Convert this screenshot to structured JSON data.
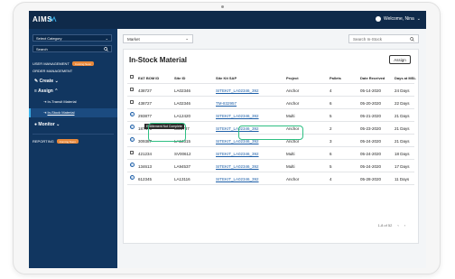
{
  "header": {
    "logo_text": "AIMS",
    "welcome_text": "Welcome, Nina"
  },
  "sidebar": {
    "category_select": "Select Category",
    "search_placeholder": "Search",
    "user_management": "USER MANAGEMENT",
    "order_management": "ORDER MANAGEMENT",
    "coming_soon": "Coming Soon",
    "create": "Create",
    "assign": "Assign",
    "in_transit": "In-Transit Material",
    "in_stock": "In-Stock Material",
    "monitor": "Monitor",
    "reporting": "REPORTING"
  },
  "main": {
    "market_select": "Market",
    "search_placeholder": "Search In-Stock",
    "title": "In-Stock Material",
    "assign_button": "Assign",
    "tooltip": "Entitlement Not Complete",
    "pagination": "1-8 of 52"
  },
  "table": {
    "columns": [
      "EAT BOM ID",
      "Site ID",
      "Site Kit SAP",
      "Project",
      "Pallets",
      "Date Received",
      "Days at MSL"
    ],
    "rows": [
      {
        "icon": "checkbox",
        "bom": "438727",
        "site": "LA02346",
        "sap": "SITEKIT_LA02346_392",
        "project": "Anchor",
        "pallets": "4",
        "date": "05-14-2020",
        "days": "24 Days"
      },
      {
        "icon": "checkbox",
        "bom": "438727",
        "site": "LA02346",
        "sap": "TM-832957",
        "project": "Anchor",
        "pallets": "6",
        "date": "05-20-2020",
        "days": "22 Days"
      },
      {
        "icon": "info",
        "bom": "293877",
        "site": "LA12420",
        "sap": "SITEKIT_LA02346_392",
        "project": "Multi",
        "pallets": "5",
        "date": "05-21-2020",
        "days": "21 Days"
      },
      {
        "icon": "info",
        "bom": "187476",
        "site": "IE25737",
        "sap": "SITEKIT_LA02346_392",
        "project": "Anchor",
        "pallets": "2",
        "date": "05-23-2020",
        "days": "21 Days"
      },
      {
        "icon": "info",
        "bom": "309387",
        "site": "LA12315",
        "sap": "SITEKIT_LA02346_392",
        "project": "Anchor",
        "pallets": "3",
        "date": "05-24-2020",
        "days": "21 Days"
      },
      {
        "icon": "checkbox",
        "bom": "421234",
        "site": "SV00612",
        "sap": "SITEKIT_LA02346_392",
        "project": "Multi",
        "pallets": "6",
        "date": "05-24-2020",
        "days": "18 Days"
      },
      {
        "icon": "info",
        "bom": "134613",
        "site": "LA94537",
        "sap": "SITEKIT_LA02346_392",
        "project": "Multi",
        "pallets": "5",
        "date": "05-24-2020",
        "days": "17 Days"
      },
      {
        "icon": "info",
        "bom": "612345",
        "site": "LA13116",
        "sap": "SITEKIT_LA02346_392",
        "project": "Anchor",
        "pallets": "4",
        "date": "05-28-2020",
        "days": "11 Days"
      }
    ]
  },
  "colors": {
    "topbar": "#0f2a4a",
    "sidebar": "#113660",
    "accent_orange": "#e8883a",
    "link_blue": "#1d5fa8",
    "highlight_green": "#2fbf83"
  }
}
